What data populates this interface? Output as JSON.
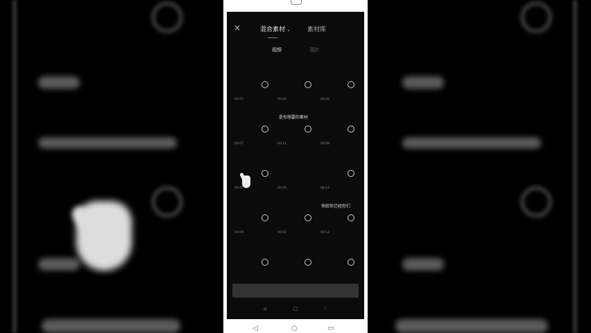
{
  "topbar": {
    "close_icon": "×",
    "tab_primary": "混合素材",
    "tab_primary_chevron": "⌄",
    "tab_secondary": "素材库"
  },
  "subtabs": [
    "视频",
    "图片"
  ],
  "grid": [
    {
      "title": "",
      "meta": "00:03"
    },
    {
      "title": "",
      "meta": "00:05"
    },
    {
      "title": "",
      "meta": "00:04"
    },
    {
      "title": "",
      "meta": "00:07"
    },
    {
      "title": "",
      "meta": "00:11"
    },
    {
      "title": "",
      "meta": "00:08"
    },
    {
      "title": "",
      "meta": "00:05"
    },
    {
      "title": "",
      "meta": "00:06"
    },
    {
      "title": "",
      "meta": "00:14"
    },
    {
      "title": "",
      "meta": "00:09"
    },
    {
      "title": "",
      "meta": "00:03"
    },
    {
      "title": "",
      "meta": "00:12"
    },
    {
      "title": "",
      "meta": ""
    },
    {
      "title": "",
      "meta": ""
    },
    {
      "title": "",
      "meta": ""
    }
  ],
  "overlay": {
    "text1": "是你想要的素材",
    "text2": "快给你已经你们"
  },
  "bottom_button": "",
  "toolbar": [
    "⌂",
    "▢",
    "⋮"
  ],
  "nav": [
    "◁",
    "○",
    "▭"
  ]
}
